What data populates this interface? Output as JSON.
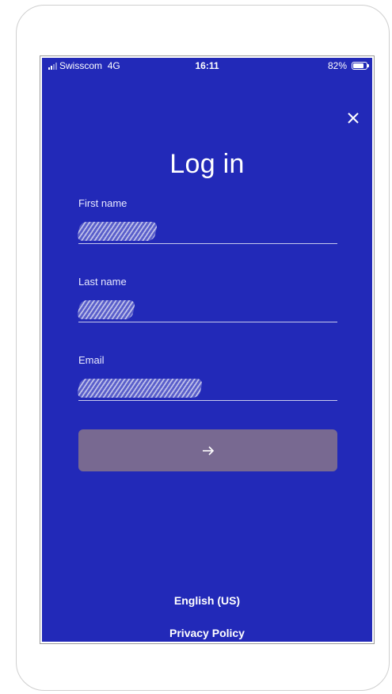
{
  "status_bar": {
    "carrier": "Swisscom",
    "network": "4G",
    "time": "16:11",
    "battery": "82%",
    "battery_level": 0.82
  },
  "title": "Log in",
  "fields": [
    {
      "label": "First name",
      "value_redacted": true
    },
    {
      "label": "Last name",
      "value_redacted": true
    },
    {
      "label": "Email",
      "value_redacted": true
    }
  ],
  "submit": {
    "icon": "arrow-right-icon"
  },
  "footer": {
    "language": "English (US)",
    "privacy": "Privacy Policy"
  },
  "colors": {
    "background": "#2229b8",
    "button": "#786991",
    "text": "#ffffff"
  },
  "close_icon": "close-icon"
}
